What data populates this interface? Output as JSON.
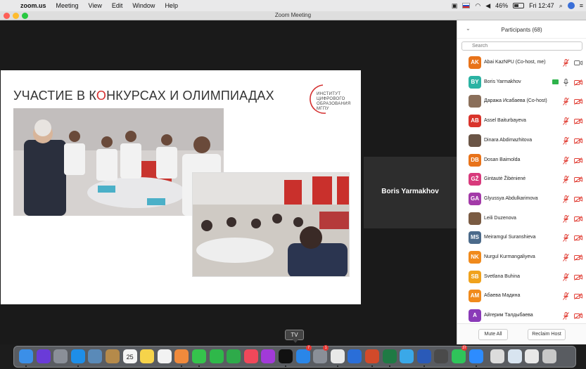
{
  "menubar": {
    "app_name": "zoom.us",
    "menus": [
      "Meeting",
      "View",
      "Edit",
      "Window",
      "Help"
    ],
    "battery": "46%",
    "battery_level": 0.46,
    "clock": "Fri 12:47"
  },
  "window": {
    "title": "Zoom Meeting"
  },
  "slide": {
    "title_before": "УЧАСТИЕ В К",
    "title_accent": "О",
    "title_after": "НКУРСАХ И ОЛИМПИАДАХ",
    "logo_lines": [
      "ИНСТИТУТ",
      "ЦИФРОВОГО",
      "ОБРАЗОВАНИЯ",
      "МГПУ"
    ]
  },
  "speaker": {
    "name": "Boris Yarmakhov"
  },
  "participants_panel": {
    "title": "Participants (68)",
    "search_placeholder": "Search",
    "participants": [
      {
        "initials": "AK",
        "name": "Abai KazNPU (Co-host, me)",
        "color": "#e8731a",
        "mic": "muted-red",
        "cam": "on"
      },
      {
        "initials": "BY",
        "name": "Boris Yarmakhov",
        "color": "#2bb3a3",
        "mic": "on",
        "cam": "off",
        "sharing": true
      },
      {
        "initials": "",
        "name": "Даража Исабаева (Co-host)",
        "color": "#8a6f5a",
        "photo": true,
        "mic": "muted-red",
        "cam": "off"
      },
      {
        "initials": "AB",
        "name": "Assel Baiturbayeva",
        "color": "#d9342b",
        "mic": "muted-red",
        "cam": "off"
      },
      {
        "initials": "",
        "name": "Dinara Abdimazhitova",
        "color": "#6a5546",
        "photo": true,
        "mic": "muted-red",
        "cam": "off"
      },
      {
        "initials": "DB",
        "name": "Dosan Baimolda",
        "color": "#e8731a",
        "mic": "muted-red",
        "cam": "off"
      },
      {
        "initials": "GŽ",
        "name": "Gintautė Žibėnienė",
        "color": "#d83a7c",
        "mic": "muted-red",
        "cam": "off"
      },
      {
        "initials": "GA",
        "name": "Glyussya Abdulkarimova",
        "color": "#a33aa8",
        "mic": "muted-red",
        "cam": "off"
      },
      {
        "initials": "",
        "name": "Leili Duzenova",
        "color": "#7a5b42",
        "photo": true,
        "mic": "muted-red",
        "cam": "off"
      },
      {
        "initials": "MS",
        "name": "Meiramgul Suranshieva",
        "color": "#4b6a8a",
        "mic": "muted-red",
        "cam": "off"
      },
      {
        "initials": "NK",
        "name": "Nurgul Kurmangaliyeva",
        "color": "#f08a1c",
        "mic": "muted-red",
        "cam": "off"
      },
      {
        "initials": "SB",
        "name": "Svetlana Buhina",
        "color": "#f0a21c",
        "mic": "muted-red",
        "cam": "off"
      },
      {
        "initials": "AM",
        "name": "Абаева Мадина",
        "color": "#f08a1c",
        "mic": "muted-red",
        "cam": "off"
      },
      {
        "initials": "A",
        "name": "Айгерим Талдыбаева",
        "color": "#8a3ab8",
        "mic": "muted-red",
        "cam": "off"
      }
    ],
    "mute_all_label": "Mute All",
    "reclaim_host_label": "Reclaim Host"
  },
  "dock": {
    "tooltip": "TV",
    "calendar_day": "25",
    "badges": [
      "7",
      "1",
      "37"
    ]
  }
}
